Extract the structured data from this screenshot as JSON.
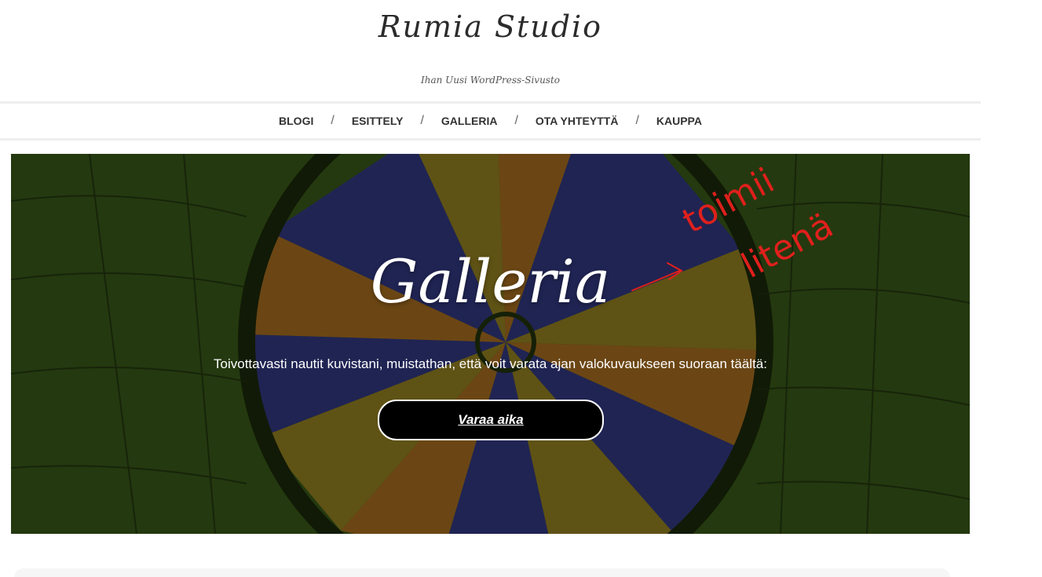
{
  "site": {
    "title": "Rumia Studio",
    "tagline": "Ihan Uusi WordPress-Sivusto"
  },
  "nav": {
    "items": [
      "BLOGI",
      "ESITTELY",
      "GALLERIA",
      "OTA YHTEYTTÄ",
      "KAUPPA"
    ],
    "separator": "/"
  },
  "hero": {
    "title": "Galleria",
    "text": "Toivottavasti nautit kuvistani, muistathan, että voit varata ajan valokuvaukseen suoraan täältä:",
    "button_label": "Varaa aika"
  },
  "annotation": {
    "text_line1": "toimii",
    "text_line2": "litenä",
    "color": "#e0201c"
  },
  "colors": {
    "hero_background": "#2f4a14",
    "button_background": "#000000",
    "nav_border": "#eeeeee"
  }
}
